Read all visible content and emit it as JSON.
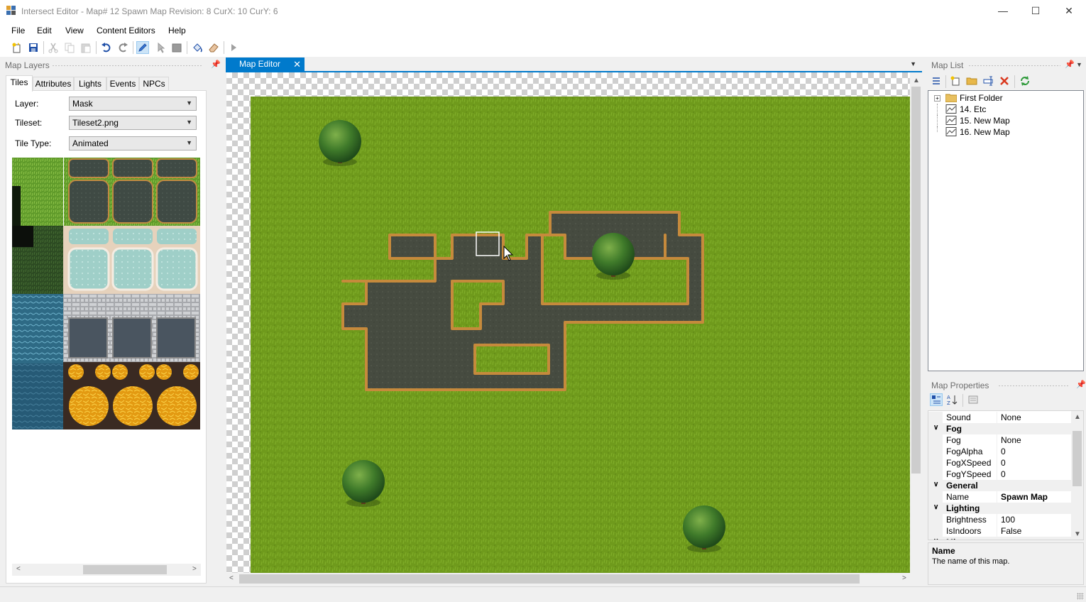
{
  "window": {
    "title": "Intersect Editor - Map# 12 Spawn Map Revision: 8 CurX: 10 CurY: 6",
    "minimize": "—",
    "maximize": "☐",
    "close": "✕"
  },
  "menu": [
    "File",
    "Edit",
    "View",
    "Content Editors",
    "Help"
  ],
  "toolbar": {
    "icons": [
      "new-map-icon",
      "save-icon",
      "cut-icon",
      "copy-icon",
      "paste-icon",
      "undo-icon",
      "redo-icon",
      "pen-icon",
      "selection-icon",
      "rectangle-icon",
      "fill-icon",
      "eraser-icon",
      "play-icon"
    ],
    "active": "pen-icon"
  },
  "map_layers": {
    "header": "Map Layers",
    "tabs": [
      "Tiles",
      "Attributes",
      "Lights",
      "Events",
      "NPCs"
    ],
    "selected_tab": "Tiles",
    "layer_label": "Layer:",
    "layer_value": "Mask",
    "tileset_label": "Tileset:",
    "tileset_value": "Tileset2.png",
    "tiletype_label": "Tile Type:",
    "tiletype_value": "Animated"
  },
  "map_editor": {
    "tab_label": "Map Editor",
    "tab_close": "✕"
  },
  "map_list": {
    "header": "Map List",
    "items": [
      {
        "label": "First Folder",
        "type": "folder"
      },
      {
        "label": "14. Etc",
        "type": "map"
      },
      {
        "label": "15. New Map",
        "type": "map"
      },
      {
        "label": "16. New Map",
        "type": "map"
      }
    ]
  },
  "map_properties": {
    "header": "Map Properties",
    "rows": [
      {
        "kind": "prop",
        "key": "Sound",
        "value": "None"
      },
      {
        "kind": "cat",
        "key": "Fog"
      },
      {
        "kind": "prop",
        "key": "Fog",
        "value": "None"
      },
      {
        "kind": "prop",
        "key": "FogAlpha",
        "value": "0"
      },
      {
        "kind": "prop",
        "key": "FogXSpeed",
        "value": "0"
      },
      {
        "kind": "prop",
        "key": "FogYSpeed",
        "value": "0"
      },
      {
        "kind": "cat",
        "key": "General"
      },
      {
        "kind": "prop",
        "key": "Name",
        "value": "Spawn Map",
        "bold": true
      },
      {
        "kind": "cat",
        "key": "Lighting"
      },
      {
        "kind": "prop",
        "key": "Brightness",
        "value": "100"
      },
      {
        "kind": "prop",
        "key": "IsIndoors",
        "value": "False"
      },
      {
        "kind": "cat",
        "key": "Misc"
      }
    ],
    "help_title": "Name",
    "help_text": "The name of this map."
  },
  "colors": {
    "accent": "#007acc",
    "grass": "#6f9a1c",
    "dirt": "#464b40",
    "dirt_border": "#c68a3c"
  }
}
